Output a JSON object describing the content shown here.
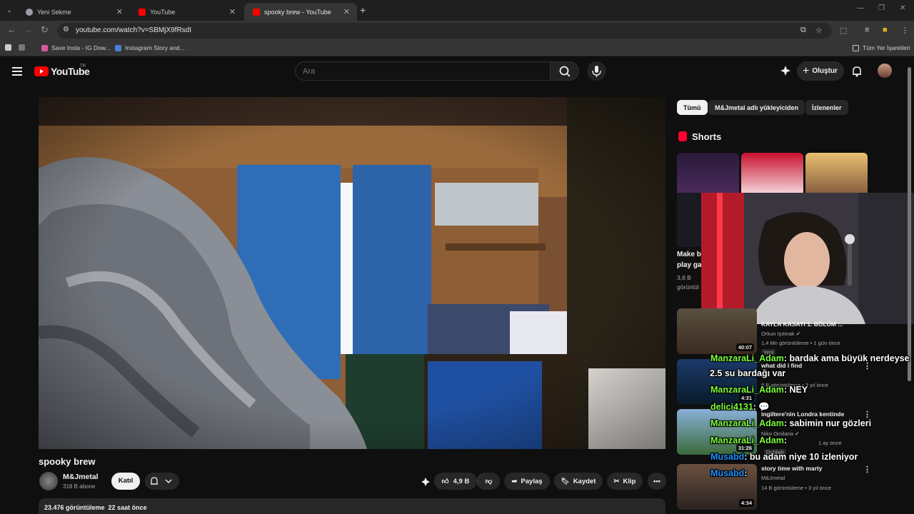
{
  "browser": {
    "tabs": [
      {
        "label": "Yeni Sekme",
        "fav_color": "#9aa0a6"
      },
      {
        "label": "YouTube",
        "fav_color": "#ff0000"
      },
      {
        "label": "spooky brew - YouTube",
        "fav_color": "#ff0000"
      }
    ],
    "url": "youtube.com/watch?v=SBMjX9fRsdI",
    "bookmarks": [
      {
        "label": "Save Insta - IG Dow..."
      },
      {
        "label": "Instagram Story and..."
      }
    ],
    "all_bookmarks": "Tüm Yer İşaretleri"
  },
  "yt": {
    "logo": "YouTube",
    "region": "TR",
    "search_placeholder": "Ara",
    "create_label": "Oluştur"
  },
  "video": {
    "title": "spooky brew",
    "channel": "M&Jmetal",
    "subscribers": "318 B abone",
    "join_label": "Katıl",
    "likes": "4,9 B",
    "share_label": "Paylaş",
    "save_label": "Kaydet",
    "clip_label": "Klip",
    "views": "23.476 görüntüleme",
    "date": "22 saat önce"
  },
  "sidebar": {
    "chips": [
      "Tümü",
      "M&Jmetal adlı yükleyiciden",
      "İzlenenler"
    ],
    "shorts_title": "Shorts",
    "short_title": "Make b",
    "short_title2": "play ga",
    "short_views": "3,8 B",
    "short_views2": "görüntül",
    "related": [
      {
        "title": "KAYLA KASAYI 1. BÖLÜM ...",
        "channel": "Orkun Işıtmak",
        "meta": "1,4 Mn görüntüleme • 1 gün önce",
        "badge": "Yeni",
        "duration": "40:07"
      },
      {
        "title": "what did i find",
        "channel": "",
        "meta": "8 B görüntüleme • 3 yıl önce",
        "badge": "",
        "duration": "4:31"
      },
      {
        "title": "İngiltere'nin Londra kentinde",
        "channel": "Niko Omilana",
        "meta": "1 ay önce",
        "badge": "Dublajlı",
        "duration": "31:26"
      },
      {
        "title": "story time with marty",
        "channel": "M&Jmetal",
        "meta": "14 B görüntüleme • 3 yıl önce",
        "badge": "",
        "duration": "4:34"
      }
    ]
  },
  "chat": [
    {
      "user": "ManzaraLi_Adam",
      "msg": ": bardak ama büyük nerdeyse"
    },
    {
      "user": "",
      "msg": "2.5 su bardağı var"
    },
    {
      "user": "ManzaraLi_Adam",
      "msg": ": NEY"
    },
    {
      "user": "delici4131",
      "msg": ": 💬"
    },
    {
      "user": "ManzaraLi_Adam",
      "msg": ": sabimin nur gözleri"
    },
    {
      "user": "ManzaraLi_Adam",
      "msg": ":"
    },
    {
      "user": "Musabd",
      "msg": ": bu adam niye 10 izleniyor"
    },
    {
      "user": "Musabd",
      "msg": ":"
    }
  ]
}
